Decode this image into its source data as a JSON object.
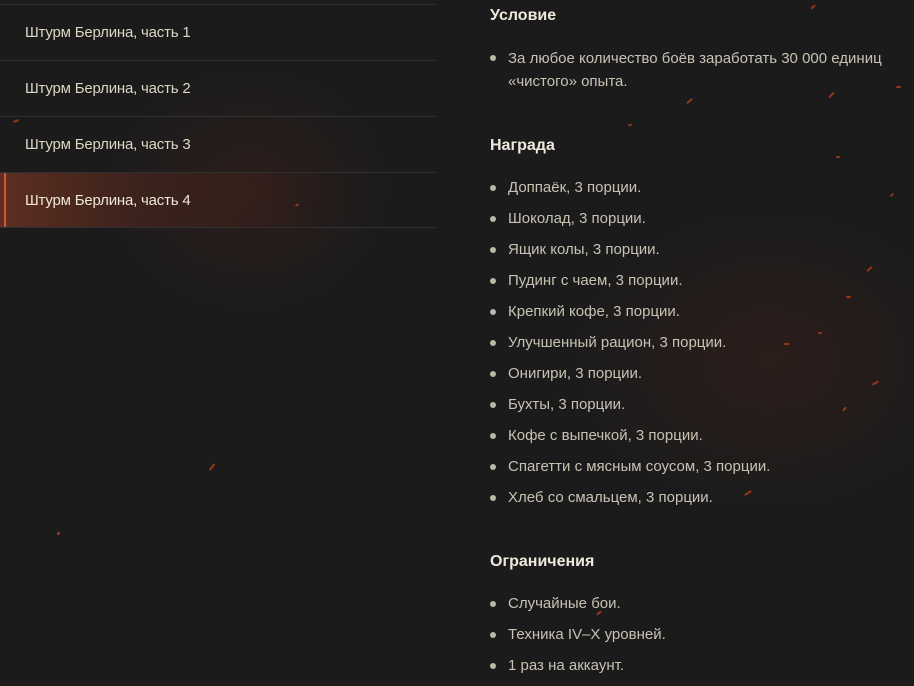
{
  "sidebar": {
    "items": [
      {
        "label": "Штурм Берлина, часть 1",
        "active": false
      },
      {
        "label": "Штурм Берлина, часть 2",
        "active": false
      },
      {
        "label": "Штурм Берлина, часть 3",
        "active": false
      },
      {
        "label": "Штурм Берлина, часть 4",
        "active": true
      }
    ]
  },
  "main": {
    "condition": {
      "title": "Условие",
      "items": [
        "За любое количество боёв заработать 30 000 единиц «чистого» опыта."
      ]
    },
    "reward": {
      "title": "Награда",
      "items": [
        "Доппаёк, 3 порции.",
        "Шоколад, 3 порции.",
        "Ящик колы, 3 порции.",
        "Пудинг с чаем, 3 порции.",
        "Крепкий кофе, 3 порции.",
        "Улучшенный рацион, 3 порции.",
        "Онигири, 3 порции.",
        "Бухты, 3 порции.",
        "Кофе с выпечкой, 3 порции.",
        "Спагетти с мясным соусом, 3 порции.",
        "Хлеб со смальцем, 3 порции."
      ]
    },
    "restrictions": {
      "title": "Ограничения",
      "items": [
        "Случайные бои.",
        "Техника IV–X уровней.",
        "1 раз на аккаунт."
      ]
    }
  },
  "colors": {
    "background": "#1b1b1c",
    "accent": "#c95a34",
    "text": "#c8c2b3",
    "heading": "#efe9dc"
  }
}
